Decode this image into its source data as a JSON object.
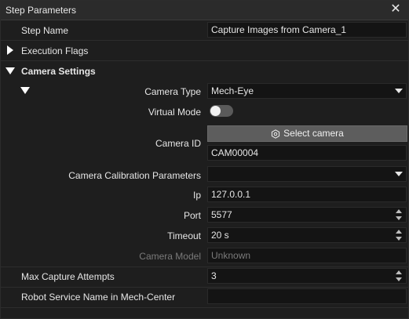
{
  "window": {
    "title": "Step Parameters",
    "close_glyph": "✕"
  },
  "step_name": {
    "label": "Step Name",
    "value": "Capture Images from Camera_1"
  },
  "execution_flags": {
    "label": "Execution Flags",
    "expanded": false
  },
  "camera_settings": {
    "label": "Camera Settings",
    "expanded": true,
    "camera_type": {
      "label": "Camera Type",
      "value": "Mech-Eye"
    },
    "virtual_mode": {
      "label": "Virtual Mode",
      "enabled": false
    },
    "camera_id": {
      "label": "Camera ID",
      "button_label": "Select camera",
      "button_icon": "hexagon-settings-icon",
      "value": "CAM00004"
    },
    "calibration": {
      "label": "Camera Calibration Parameters",
      "value": ""
    },
    "ip": {
      "label": "Ip",
      "value": "127.0.0.1"
    },
    "port": {
      "label": "Port",
      "value": "5577"
    },
    "timeout": {
      "label": "Timeout",
      "value": "20 s"
    },
    "camera_model": {
      "label": "Camera Model",
      "value": "Unknown"
    }
  },
  "max_capture_attempts": {
    "label": "Max Capture Attempts",
    "value": "3"
  },
  "robot_service": {
    "label": "Robot Service Name in Mech-Center",
    "value": ""
  },
  "colors": {
    "background": "#1e1e1e",
    "field": "#141414",
    "button": "#5d5d5d",
    "text": "#e6e6e6",
    "disabled_text": "#7a7a7a"
  }
}
